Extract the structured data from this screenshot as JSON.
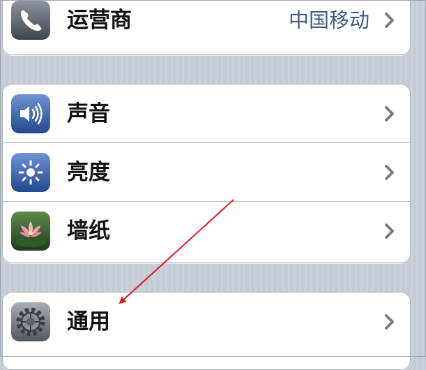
{
  "carrier_group": {
    "rows": [
      {
        "label": "运营商",
        "value": "中国移动",
        "icon": "phone-icon"
      }
    ]
  },
  "display_group": {
    "rows": [
      {
        "label": "声音",
        "icon": "speaker-icon"
      },
      {
        "label": "亮度",
        "icon": "sun-icon"
      },
      {
        "label": "墙纸",
        "icon": "lotus-wallpaper-icon"
      }
    ]
  },
  "general_group": {
    "rows": [
      {
        "label": "通用",
        "icon": "gear-icon"
      }
    ]
  },
  "colors": {
    "background": "#c5ccd4",
    "value_text": "#3d5a8a",
    "annotation_arrow": "#e0191f"
  }
}
